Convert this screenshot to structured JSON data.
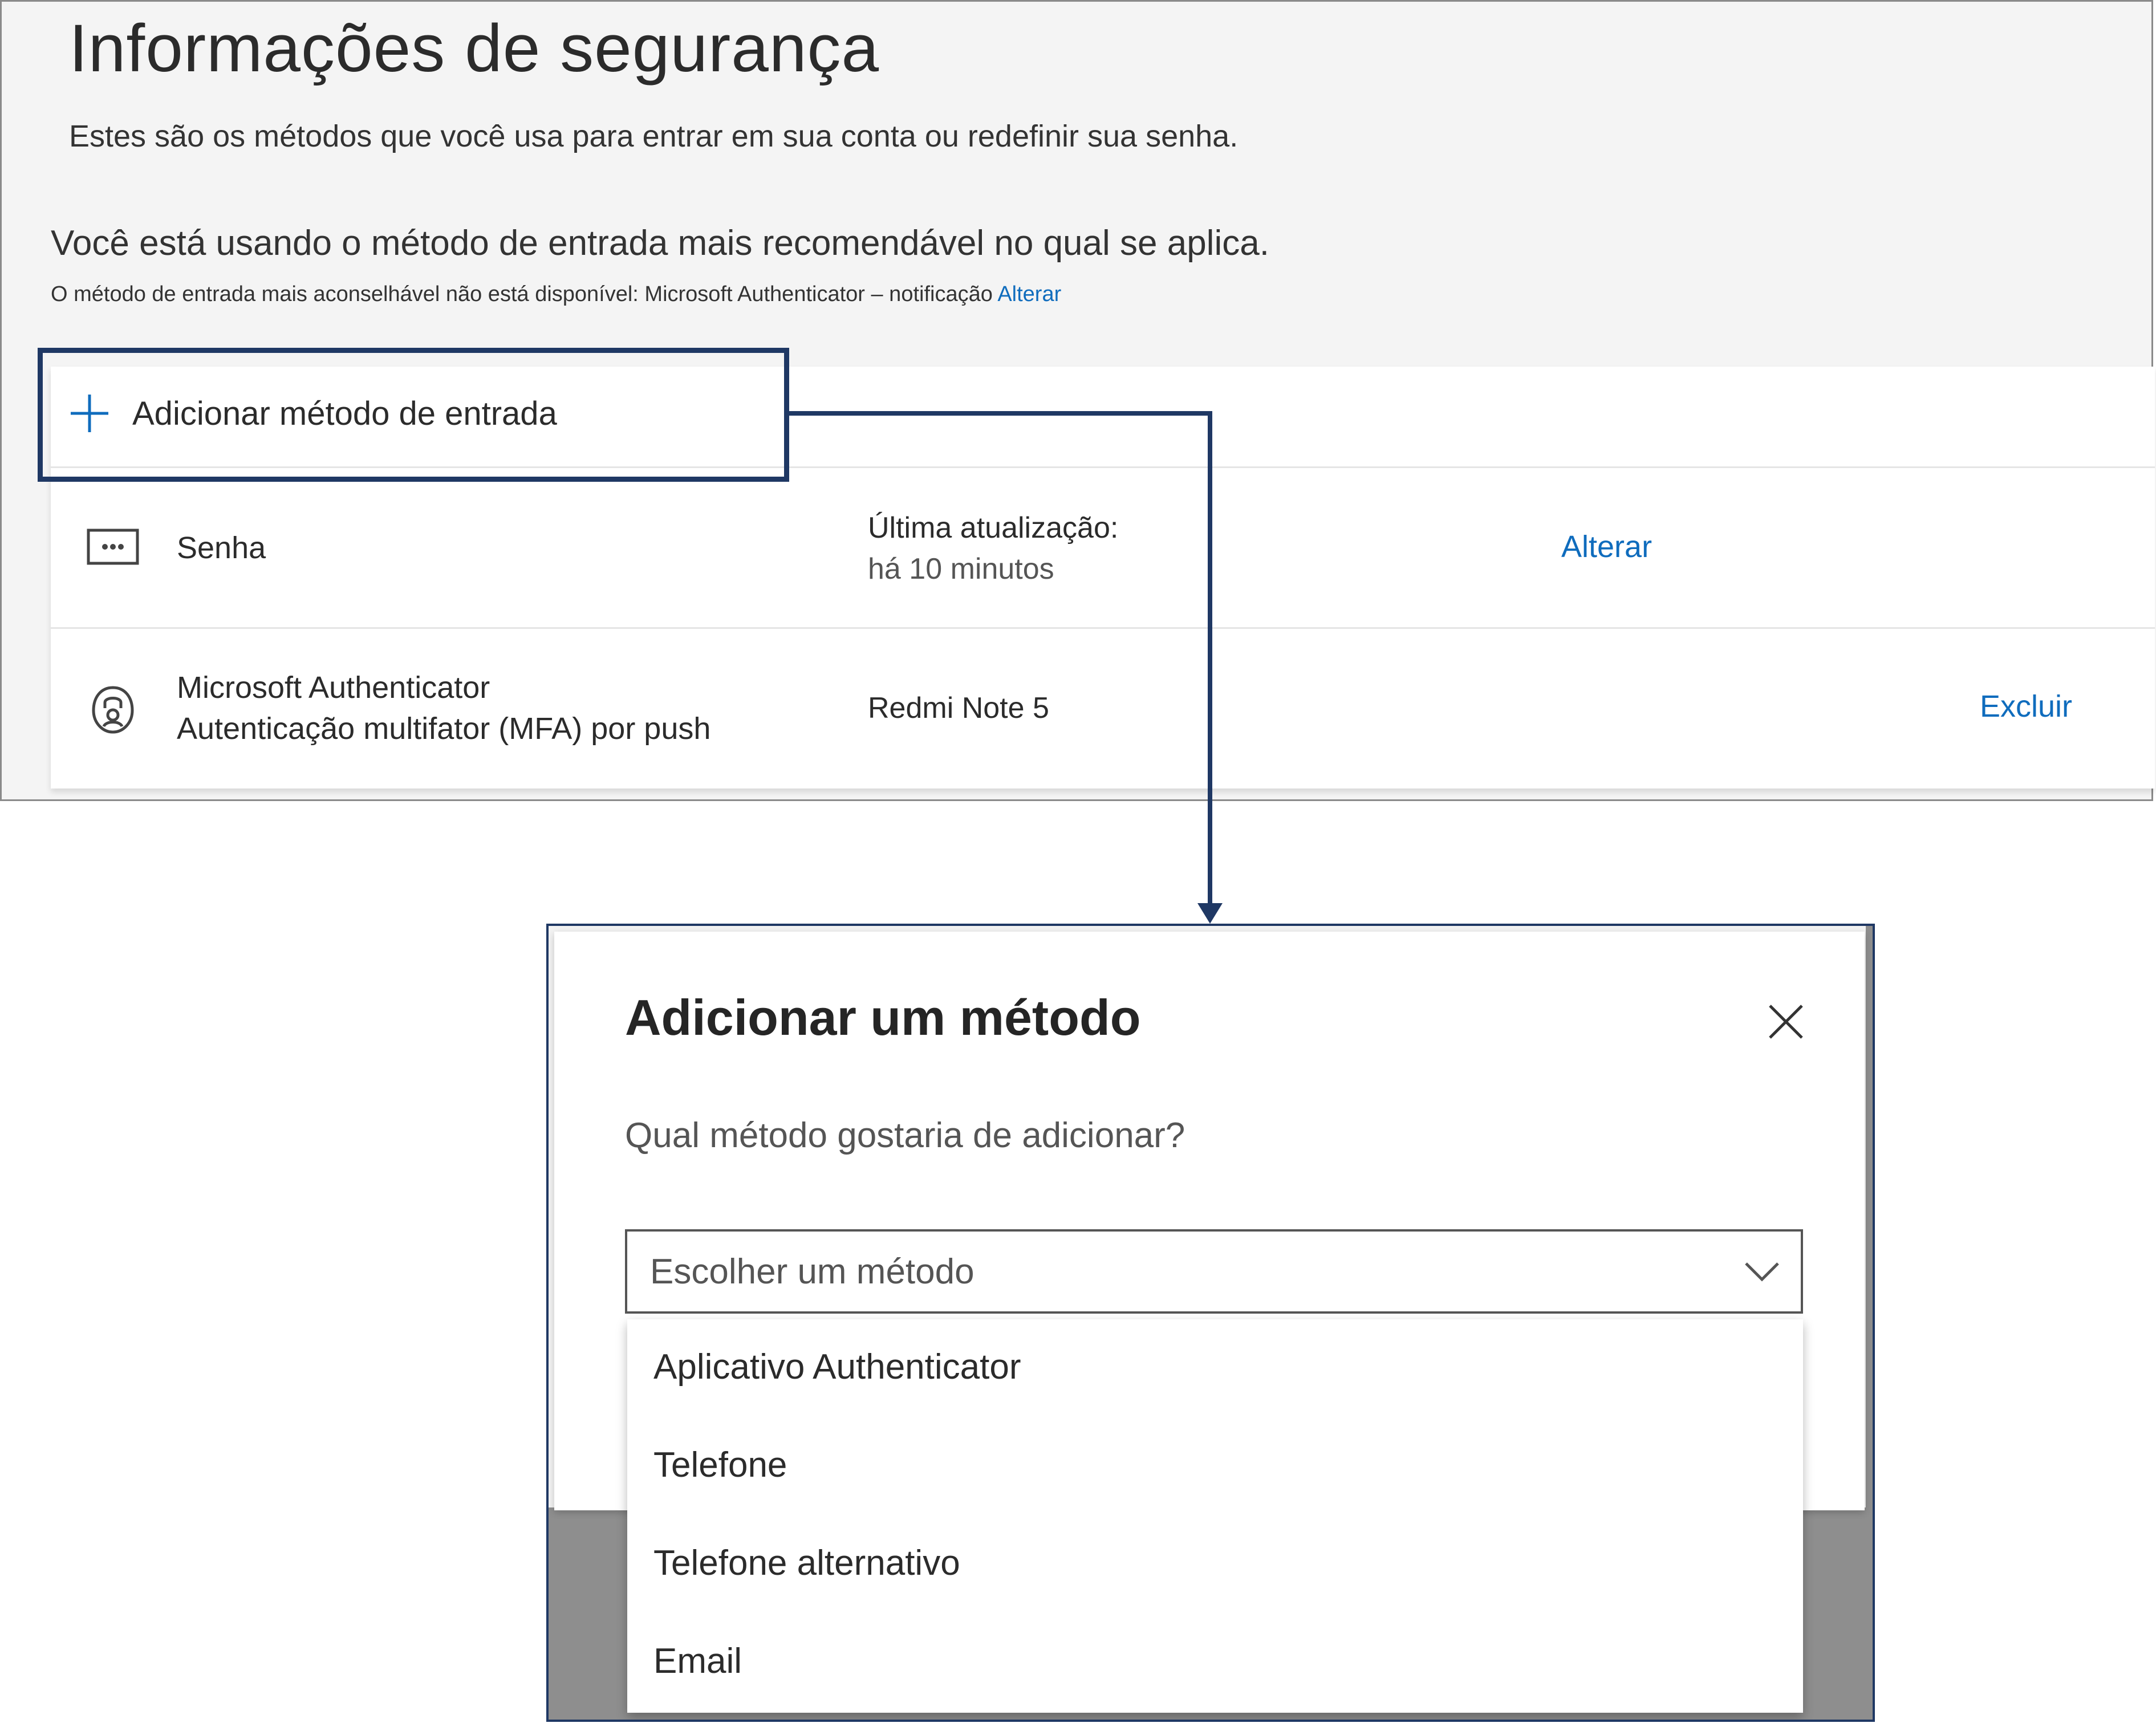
{
  "security_page": {
    "title": "Informações de segurança",
    "subtitle": "Estes são os métodos que você usa para entrar em sua conta ou redefinir sua senha.",
    "recommendation": "Você está usando o método de entrada mais recomendável no qual se aplica.",
    "recommendation_note": "O método de entrada mais aconselhável não está disponível: Microsoft Authenticator – notificação",
    "recommendation_link": "Alterar",
    "add_method_label": "Adicionar método de entrada",
    "methods": [
      {
        "icon": "password-dots-icon",
        "name": "Senha",
        "meta_line1": "Última atualização:",
        "meta_line2": "há 10 minutos",
        "action": "Alterar"
      },
      {
        "icon": "authenticator-lock-icon",
        "name": "Microsoft Authenticator",
        "name_line2": "Autenticação multifator (MFA) por push",
        "meta_line1": "Redmi Note 5",
        "action": "Excluir"
      }
    ]
  },
  "dialog": {
    "title": "Adicionar um método",
    "question": "Qual método gostaria de adicionar?",
    "select_placeholder": "Escolher um método",
    "options": [
      "Aplicativo Authenticator",
      "Telefone",
      "Telefone alternativo",
      "Email"
    ]
  },
  "colors": {
    "accent_link": "#0f6cbd",
    "highlight_border": "#1f3864"
  }
}
